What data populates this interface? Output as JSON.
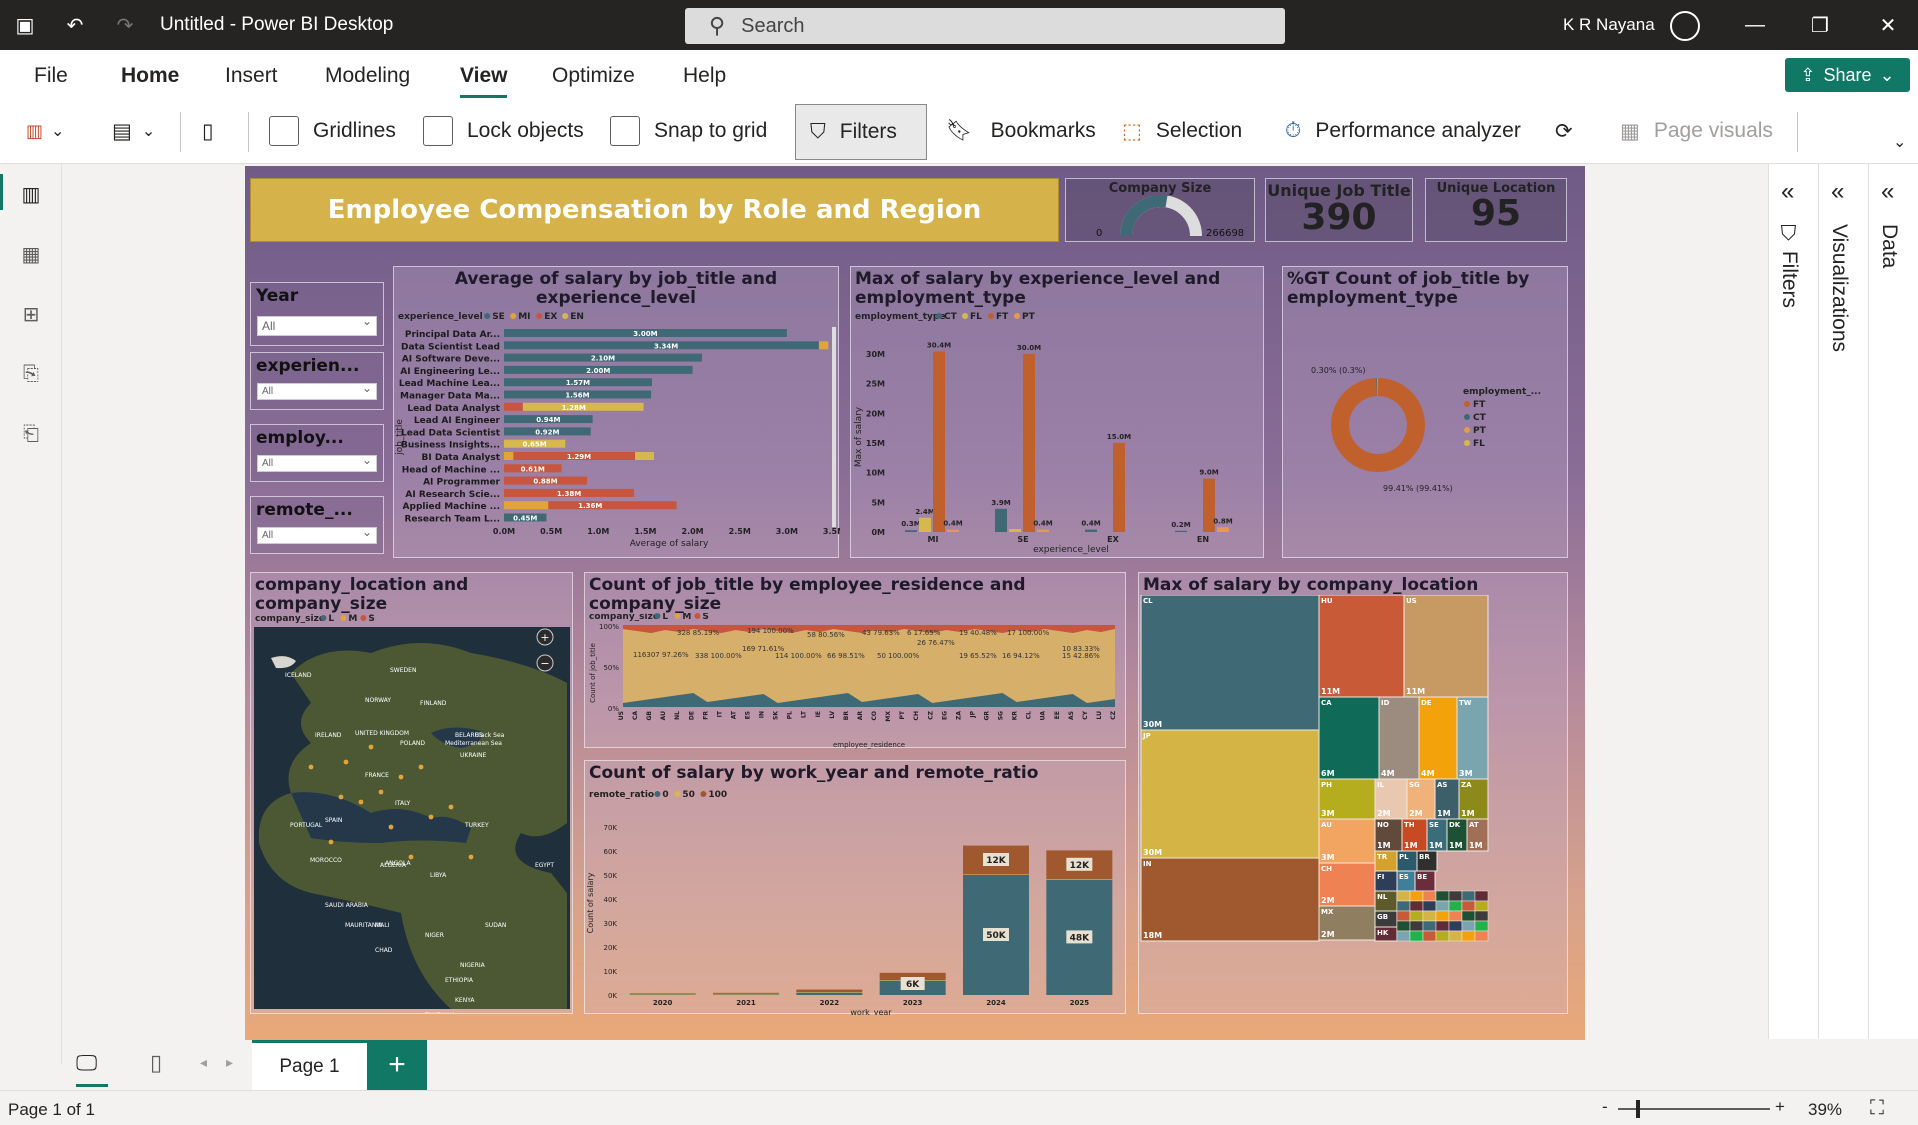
{
  "app": {
    "title": "Untitled - Power BI Desktop",
    "search_placeholder": "Search",
    "user": "K R Nayana"
  },
  "menu": {
    "tabs": [
      "File",
      "Home",
      "Insert",
      "Modeling",
      "View",
      "Optimize",
      "Help"
    ],
    "share_label": "Share"
  },
  "ribbon": {
    "gridlines": "Gridlines",
    "lock_objects": "Lock objects",
    "snap_to_grid": "Snap to grid",
    "filters": "Filters",
    "bookmarks": "Bookmarks",
    "selection": "Selection",
    "performance_analyzer": "Performance analyzer",
    "page_visuals": "Page visuals"
  },
  "panes": {
    "filters": "Filters",
    "visualizations": "Visualizations",
    "data": "Data"
  },
  "report": {
    "title": "Employee Compensation by Role and Region",
    "gauge": {
      "label": "Company Size",
      "min": "0",
      "max": "266698",
      "value_fraction": 0.55
    },
    "kpi_job_title": {
      "label": "Unique Job Title",
      "value": "390"
    },
    "kpi_location": {
      "label": "Unique Location",
      "value": "95"
    },
    "slicers": [
      {
        "title": "Year",
        "value": "All"
      },
      {
        "title": "experien...",
        "value": "All"
      },
      {
        "title": "employ...",
        "value": "All"
      },
      {
        "title": "remote_...",
        "value": "All"
      }
    ],
    "salary_job": {
      "title": "Average of salary by job_title and experience_level",
      "legend_label": "experience_level",
      "legend": [
        "SE",
        "MI",
        "EX",
        "EN"
      ],
      "ylabel": "job_title",
      "xlabel": "Average of salary",
      "ticks": [
        "0.0M",
        "0.5M",
        "1.0M",
        "1.5M",
        "2.0M",
        "2.5M",
        "3.0M",
        "3.5M"
      ]
    },
    "salary_exp": {
      "title": "Max of salary by experience_level and employment_type",
      "legend_label": "employment_type",
      "legend": [
        "CT",
        "FL",
        "FT",
        "PT"
      ],
      "ylabel": "Max of salary",
      "xlabel": "experience_level",
      "ticks": [
        "0M",
        "5M",
        "10M",
        "15M",
        "20M",
        "25M",
        "30M"
      ]
    },
    "donut": {
      "title": "%GT Count of job_title by employment_type",
      "legend_label": "employment_...",
      "legend": [
        "FT",
        "CT",
        "PT",
        "FL"
      ],
      "label_small": "0.30% (0.3%)",
      "label_big": "99.41% (99.41%)"
    },
    "map": {
      "title": "company_location and company_size",
      "legend_label": "company_size",
      "legend": [
        "L",
        "M",
        "S"
      ],
      "places": [
        "ICELAND",
        "SWEDEN",
        "NORWAY",
        "FINLAND",
        "UNITED KINGDOM",
        "IRELAND",
        "POLAND",
        "BELARUS",
        "UKRAINE",
        "FRANCE",
        "ITALY",
        "SPAIN",
        "PORTUGAL",
        "TURKEY",
        "Black Sea",
        "MOROCCO",
        "ALGERIA",
        "LIBYA",
        "EGYPT",
        "SAUDI ARABIA",
        "MAURITANIA",
        "MALI",
        "NIGER",
        "CHAD",
        "SUDAN",
        "NIGERIA",
        "ETHIOPIA",
        "KENYA",
        "TANZANIA",
        "ANGOLA",
        "Mediterranean Sea",
        "Microsoft Bing"
      ]
    },
    "residence": {
      "title": "Count of job_title by employee_residence and company_size",
      "legend_label": "company_size",
      "legend": [
        "L",
        "M",
        "S"
      ],
      "ylabel": "Count of job_title",
      "xlabel": "employee_residence",
      "ticks": [
        "100%",
        "50%",
        "0%"
      ]
    },
    "work_year": {
      "title": "Count of salary by work_year and remote_ratio",
      "legend_label": "remote_ratio",
      "legend": [
        "0",
        "50",
        "100"
      ],
      "ylabel": "Count of salary",
      "xlabel": "work_year",
      "ticks": [
        "0K",
        "10K",
        "20K",
        "30K",
        "40K",
        "50K",
        "60K",
        "70K"
      ]
    },
    "treemap": {
      "title": "Max of salary by company_location"
    }
  },
  "chart_data": [
    {
      "type": "bar",
      "title": "Average of salary by job_title and experience_level",
      "xlabel": "Average of salary",
      "ylabel": "job_title",
      "xlim": [
        0,
        3.5
      ],
      "categories": [
        "Principal Data Ar...",
        "Data Scientist Lead",
        "AI Software Deve...",
        "AI Engineering Le...",
        "Lead Machine Lea...",
        "Manager Data Ma...",
        "Lead Data Analyst",
        "Lead AI Engineer",
        "Lead Data Scientist",
        "Business Insights...",
        "BI Data Analyst",
        "Head of Machine ...",
        "AI Programmer",
        "AI Research Scie...",
        "Applied Machine ...",
        "Research Team L..."
      ],
      "series": [
        {
          "name": "SE",
          "values": [
            3.0,
            3.34,
            2.1,
            2.0,
            1.57,
            1.56,
            0,
            0.94,
            0.92,
            0,
            0,
            0,
            0,
            0,
            0,
            0.45
          ]
        },
        {
          "name": "MI",
          "values": [
            0,
            0.1,
            0,
            0,
            0,
            0,
            0,
            0,
            0,
            0,
            0.1,
            0,
            0,
            0,
            0.47,
            0
          ]
        },
        {
          "name": "EX",
          "values": [
            0,
            0,
            0,
            0,
            0,
            0,
            0.2,
            0,
            0,
            0,
            1.29,
            0.61,
            0.88,
            1.38,
            1.36,
            0
          ]
        },
        {
          "name": "EN",
          "values": [
            0,
            0,
            0,
            0,
            0,
            0,
            1.28,
            0,
            0,
            0.65,
            0.2,
            0,
            0,
            0,
            0,
            0
          ]
        }
      ],
      "labels": [
        "3.00M",
        "3.34M",
        "2.10M",
        "2.00M",
        "1.57M",
        "1.56M",
        "1.28M",
        "0.94M",
        "0.92M",
        "0.65M",
        "1.29M",
        "0.61M",
        "0.88M",
        "1.38M",
        "1.36M",
        "0.45M"
      ],
      "label_mi": "0.47M"
    },
    {
      "type": "bar",
      "title": "Max of salary by experience_level and employment_type",
      "categories": [
        "MI",
        "SE",
        "EX",
        "EN"
      ],
      "ylim": [
        0,
        32
      ],
      "series": [
        {
          "name": "CT",
          "values": [
            0.3,
            3.9,
            0.4,
            0.2
          ]
        },
        {
          "name": "FL",
          "values": [
            2.4,
            0.5,
            0,
            0
          ]
        },
        {
          "name": "FT",
          "values": [
            30.4,
            30.0,
            15.0,
            9.0
          ]
        },
        {
          "name": "PT",
          "values": [
            0.4,
            0.4,
            0,
            0.8
          ]
        }
      ],
      "labels": [
        [
          "0.3M",
          "2.4M",
          "30.4M",
          "0.4M"
        ],
        [
          "3.9M",
          "",
          "30.0M",
          "0.4M"
        ],
        [
          "0.4M",
          "",
          "15.0M",
          ""
        ],
        [
          "0.2M",
          "",
          "9.0M",
          "0.8M"
        ]
      ]
    },
    {
      "type": "pie",
      "title": "%GT Count of job_title by employment_type",
      "categories": [
        "FT",
        "CT",
        "PT",
        "FL"
      ],
      "values": [
        99.41,
        0.3,
        0.17,
        0.12
      ]
    },
    {
      "type": "area",
      "title": "Count of job_title by employee_residence and company_size",
      "categories": [
        "US",
        "CA",
        "GB",
        "AU",
        "NL",
        "DE",
        "FR",
        "IT",
        "AT",
        "ES",
        "IN",
        "SK",
        "PL",
        "LT",
        "IE",
        "LV",
        "BR",
        "AR",
        "CO",
        "MX",
        "PT",
        "CH",
        "CZ",
        "EG",
        "ZA",
        "JP",
        "GR",
        "SG",
        "KR",
        "CL",
        "UA",
        "EE",
        "AS",
        "CY",
        "LU",
        "CZ"
      ],
      "annotations": [
        "328 85.19%",
        "194 100.00%",
        "58 80.56%",
        "43 79.63%",
        "6 17.65%",
        "19 40.48%",
        "17 100.00%",
        "116307 97.26%",
        "338 100.00%",
        "169 71.61%",
        "114 100.00%",
        "66 98.51%",
        "50 100.00%",
        "26 76.47%",
        "19 65.52%",
        "16 94.12%",
        "10 83.33%",
        "15 42.86%"
      ]
    },
    {
      "type": "bar",
      "title": "Count of salary by work_year and remote_ratio",
      "categories": [
        "2020",
        "2021",
        "2022",
        "2023",
        "2024",
        "2025"
      ],
      "ylim": [
        0,
        70
      ],
      "series": [
        {
          "name": "0",
          "values": [
            0.1,
            0.2,
            1.0,
            6.0,
            50.0,
            48.0
          ]
        },
        {
          "name": "50",
          "values": [
            0.05,
            0.05,
            0.1,
            0.2,
            0.2,
            0.2
          ]
        },
        {
          "name": "100",
          "values": [
            0.2,
            0.4,
            1.0,
            3.0,
            12.0,
            12.0
          ]
        }
      ],
      "labels": {
        "2023": "6K",
        "2024_0": "50K",
        "2024_100": "12K",
        "2025_0": "48K",
        "2025_100": "12K"
      }
    },
    {
      "type": "treemap",
      "title": "Max of salary by company_location",
      "cells": [
        {
          "name": "CL",
          "label": "30M",
          "color": "#3f6a75"
        },
        {
          "name": "JP",
          "label": "30M",
          "color": "#d3b445"
        },
        {
          "name": "IN",
          "label": "18M",
          "color": "#a0582f"
        },
        {
          "name": "HU",
          "label": "11M",
          "color": "#c85a38"
        },
        {
          "name": "US",
          "label": "11M",
          "color": "#c79a63"
        },
        {
          "name": "CA",
          "label": "6M",
          "color": "#0f6a57"
        },
        {
          "name": "ID",
          "label": "4M",
          "color": "#9c8c80"
        },
        {
          "name": "DE",
          "label": "4M",
          "color": "#f3a20c"
        },
        {
          "name": "TW",
          "label": "3M",
          "color": "#7aa4ae"
        },
        {
          "name": "PH",
          "label": "3M",
          "color": "#b5ac1e"
        },
        {
          "name": "IL",
          "label": "2M",
          "color": "#e8c8b0"
        },
        {
          "name": "SG",
          "label": "2M",
          "color": "#f0b27a"
        },
        {
          "name": "AS",
          "label": "1M",
          "color": "#3d5f6a"
        },
        {
          "name": "ZA",
          "label": "1M",
          "color": "#8b8a1b"
        },
        {
          "name": "AU",
          "label": "3M",
          "color": "#f1a560"
        },
        {
          "name": "NO",
          "label": "1M",
          "color": "#5f4a3c"
        },
        {
          "name": "TH",
          "label": "1M",
          "color": "#c74a22"
        },
        {
          "name": "SE",
          "label": "1M",
          "color": "#3b6c7a"
        },
        {
          "name": "DK",
          "label": "1M",
          "color": "#1e5134"
        },
        {
          "name": "AT",
          "label": "1M",
          "color": "#a16e56"
        },
        {
          "name": "CH",
          "label": "2M",
          "color": "#ef8253"
        },
        {
          "name": "TR",
          "label": "",
          "color": "#d3a12c"
        },
        {
          "name": "PL",
          "label": "",
          "color": "#2b5a6a"
        },
        {
          "name": "BR",
          "label": "",
          "color": "#2f2f2f"
        },
        {
          "name": "MX",
          "label": "2M",
          "color": "#8f7e5f"
        },
        {
          "name": "FI",
          "label": "",
          "color": "#2f3e58"
        },
        {
          "name": "ES",
          "label": "",
          "color": "#3f7f9a"
        },
        {
          "name": "BE",
          "label": "",
          "color": "#6a2d3b"
        },
        {
          "name": "NL",
          "label": "",
          "color": "#5e5a2a"
        },
        {
          "name": "GB",
          "label": "",
          "color": "#3c3c3c"
        },
        {
          "name": "CZ",
          "label": "",
          "color": "#22b24c"
        },
        {
          "name": "HK",
          "label": "",
          "color": "#622c36"
        }
      ]
    }
  ],
  "status": {
    "page_tab": "Page 1",
    "page_count": "Page 1 of 1",
    "zoom": "39%"
  }
}
